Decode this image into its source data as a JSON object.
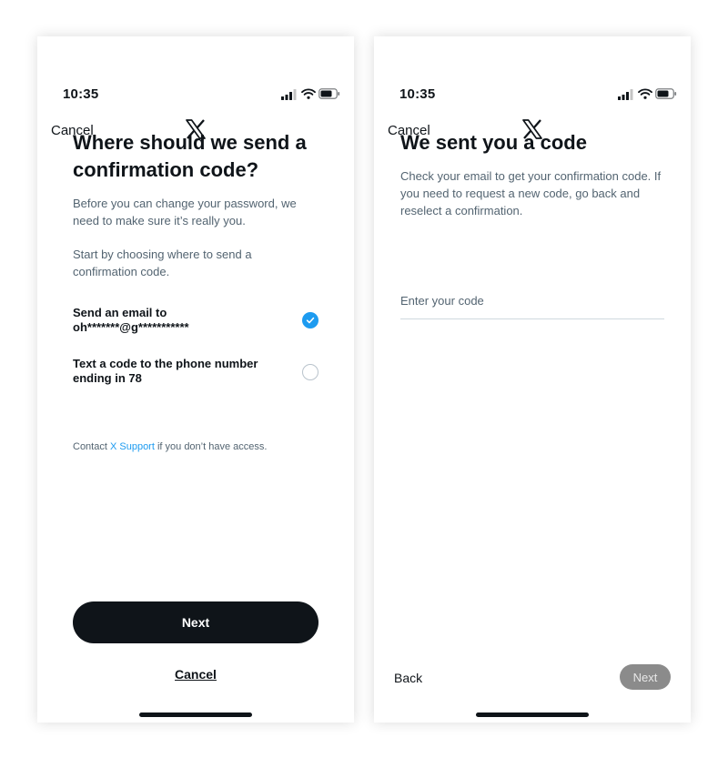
{
  "left_screen": {
    "status": {
      "time": "10:35"
    },
    "nav": {
      "cancel": "Cancel",
      "logo_icon": "x-logo-icon"
    },
    "title": "Where should we send a confirmation code?",
    "intro": "Before you can change your password, we need to make sure it’s really you.",
    "instruction": "Start by choosing where to send a confirmation code.",
    "options": [
      {
        "label": "Send an email to oh*******@g***********",
        "selected": true
      },
      {
        "label": "Text a code to the phone number ending in 78",
        "selected": false
      }
    ],
    "contact": {
      "prefix": "Contact",
      "link": "X Support",
      "suffix": "if you don’t have access."
    },
    "next_button": "Next",
    "cancel_button": "Cancel"
  },
  "right_screen": {
    "status": {
      "time": "10:35"
    },
    "nav": {
      "cancel": "Cancel",
      "logo_icon": "x-logo-icon"
    },
    "title": "We sent you a code",
    "description": "Check your email to get your confirmation code. If you need to request a new code, go back and reselect a confirmation.",
    "code_input": {
      "placeholder": "Enter your code",
      "value": ""
    },
    "back_button": "Back",
    "next_button": "Next"
  },
  "colors": {
    "accent": "#1d9bf0",
    "primary_button": "#0f1419",
    "disabled_button": "#8b8b8b",
    "secondary_text": "#536471"
  }
}
